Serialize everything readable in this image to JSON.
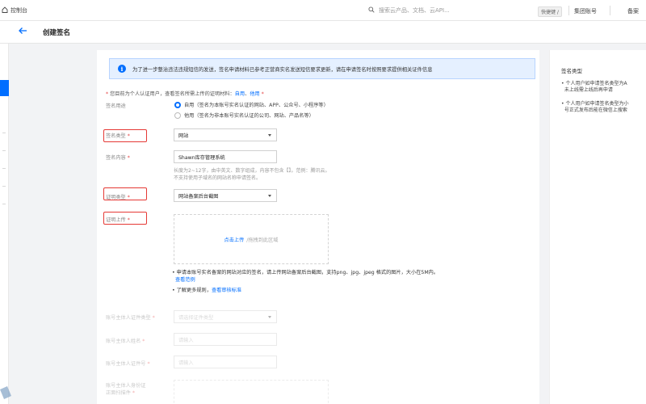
{
  "topbar": {
    "home_label": "控制台",
    "search_placeholder": "搜索云产品、文档、云API...",
    "shortcut_label": "快捷键 /",
    "link_group": "集团账号",
    "link_more": "备案"
  },
  "header": {
    "title": "创建签名",
    "back_icon": "arrow-left-icon"
  },
  "notice": {
    "icon": "info-icon",
    "text": "为了进一步整治违法违规短信的发送，签名申请材料已参考正营商实名发送短信要求更新，请在申请签名时按照要求提供相关证件信息"
  },
  "hint": {
    "prefix": "* ",
    "text": "您目前为个人认证用户，查看签名所需上传的证明材料：",
    "link_self": "自用",
    "separator": "、",
    "link_other": "他用",
    "suffix": " *"
  },
  "form": {
    "purpose": {
      "label": "签名用途",
      "option_self": "自用（签名为本账号实名认证的网站、APP、公众号、小程序等）",
      "option_other": "他用（签名为非本账号实名认证的公司、网站、产品名等）"
    },
    "sign_type": {
      "label": "签名类型",
      "required": "*",
      "value": "网站"
    },
    "sign_content": {
      "label": "签名内容",
      "required": "*",
      "value": "Shawn库存管理系统",
      "desc_1": "长度为2~12字，由中英文、数字组成，内容不包含【】。范例：腾讯云。",
      "desc_2": "不支持使用子域名的网站名称申请签名。"
    },
    "cert_type": {
      "label": "证明类型",
      "required": "*",
      "value": "网站备案后台截图"
    },
    "cert_upload": {
      "label": "证明上传",
      "required": "*",
      "link": "点击上传",
      "hint": "/拖拽到此区域",
      "note": "申请本账号实名备案的网站对应的签名，请上传网站备案后台截图，支持png、jpg、jpeg 格式的图片，大小在5M内。",
      "note_link": "查看范例",
      "more": "了解更多规则，",
      "more_link": "查看审核标准"
    },
    "holder_id_type": {
      "label": "账号主体人证件类型",
      "required": "*",
      "placeholder": "请选择证件类型"
    },
    "holder_name": {
      "label": "账号主体人姓名",
      "required": "*",
      "placeholder": "请输入"
    },
    "holder_id_no": {
      "label": "账号主体人证件号",
      "required": "*",
      "placeholder": "请输入"
    },
    "holder_id_photo": {
      "label_1": "账号主体人身份证",
      "label_2": "正面扫描件",
      "required": "*"
    }
  },
  "sidebar_right": {
    "title": "签名类型",
    "items": [
      {
        "line_1": "个人用户如申请签名类型为A",
        "line_2": "未上线需上线后再申请"
      },
      {
        "line_1": "个人用户如申请签名类型为小",
        "line_2": "号正式发布后能在微信上搜索"
      }
    ]
  },
  "colors": {
    "accent": "#006eff",
    "highlight_box": "#e53935",
    "notice_bg": "#e5f0ff"
  }
}
